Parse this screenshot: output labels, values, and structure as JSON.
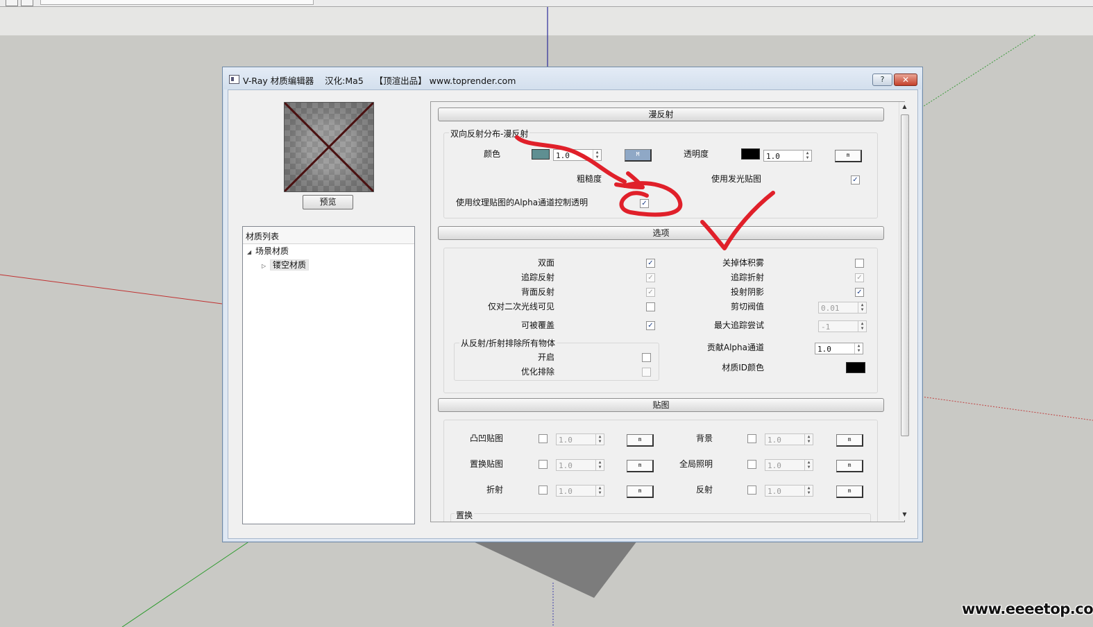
{
  "window": {
    "title": "V-Ray 材质编辑器    汉化:Ma5    【顶渲出品】 www.toprender.com",
    "help_label": "?",
    "close_label": "✕"
  },
  "left": {
    "preview_label": "预览",
    "list_header": "材质列表",
    "tree": {
      "root": "场景材质",
      "child": "镂空材质"
    }
  },
  "diffuse": {
    "section_title": "漫反射",
    "group_title": "双向反射分布-漫反射",
    "color_label": "颜色",
    "color_value": "1.0",
    "color_swatch": "#5f8f92",
    "map_btn_color": "M",
    "transparency_label": "透明度",
    "transparency_value": "1.0",
    "transparency_swatch": "#000000",
    "map_btn_trans": "m",
    "roughness_label": "粗糙度",
    "use_glow_label": "使用发光贴图",
    "use_glow_checked": "✓",
    "alpha_label": "使用纹理贴图的Alpha通道控制透明",
    "alpha_checked": "✓"
  },
  "options": {
    "section_title": "选项",
    "left": [
      {
        "label": "双面",
        "mark": "✓",
        "disabled": false
      },
      {
        "label": "追踪反射",
        "mark": "✓",
        "disabled": true
      },
      {
        "label": "背面反射",
        "mark": "✓",
        "disabled": true
      },
      {
        "label": "仅对二次光线可见",
        "mark": "",
        "disabled": false
      },
      {
        "label": "可被覆盖",
        "mark": "✓",
        "disabled": false
      }
    ],
    "right": [
      {
        "label": "关掉体积雾",
        "mark": ""
      },
      {
        "label": "追踪折射",
        "mark": "✓"
      },
      {
        "label": "投射阴影",
        "mark": "✓"
      }
    ],
    "cutoff_label": "剪切阀值",
    "cutoff_value": "0.01",
    "max_trace_label": "最大追踪尝试",
    "max_trace_value": "-1",
    "alpha_contrib_label": "贡献Alpha通道",
    "alpha_contrib_value": "1.0",
    "mat_id_label": "材质ID颜色",
    "mat_id_color": "#000000",
    "exclude_group_title": "从反射/折射排除所有物体",
    "exclude_on_label": "开启",
    "exclude_opt_label": "优化排除"
  },
  "maps": {
    "section_title": "贴图",
    "left": [
      {
        "label": "凸凹贴图",
        "value": "1.0",
        "btn": "m"
      },
      {
        "label": "置换贴图",
        "value": "1.0",
        "btn": "m"
      },
      {
        "label": "折射",
        "value": "1.0",
        "btn": "m"
      }
    ],
    "right": [
      {
        "label": "背景",
        "value": "1.0",
        "btn": "m"
      },
      {
        "label": "全局照明",
        "value": "1.0",
        "btn": "m"
      },
      {
        "label": "反射",
        "value": "1.0",
        "btn": "m"
      }
    ],
    "displacement_label": "置换"
  },
  "watermark": "www.eeeetop.com",
  "colors": {
    "annotation_red": "#e0202a",
    "dialog_border": "#6f8aa8",
    "close_red": "#c5412b"
  }
}
